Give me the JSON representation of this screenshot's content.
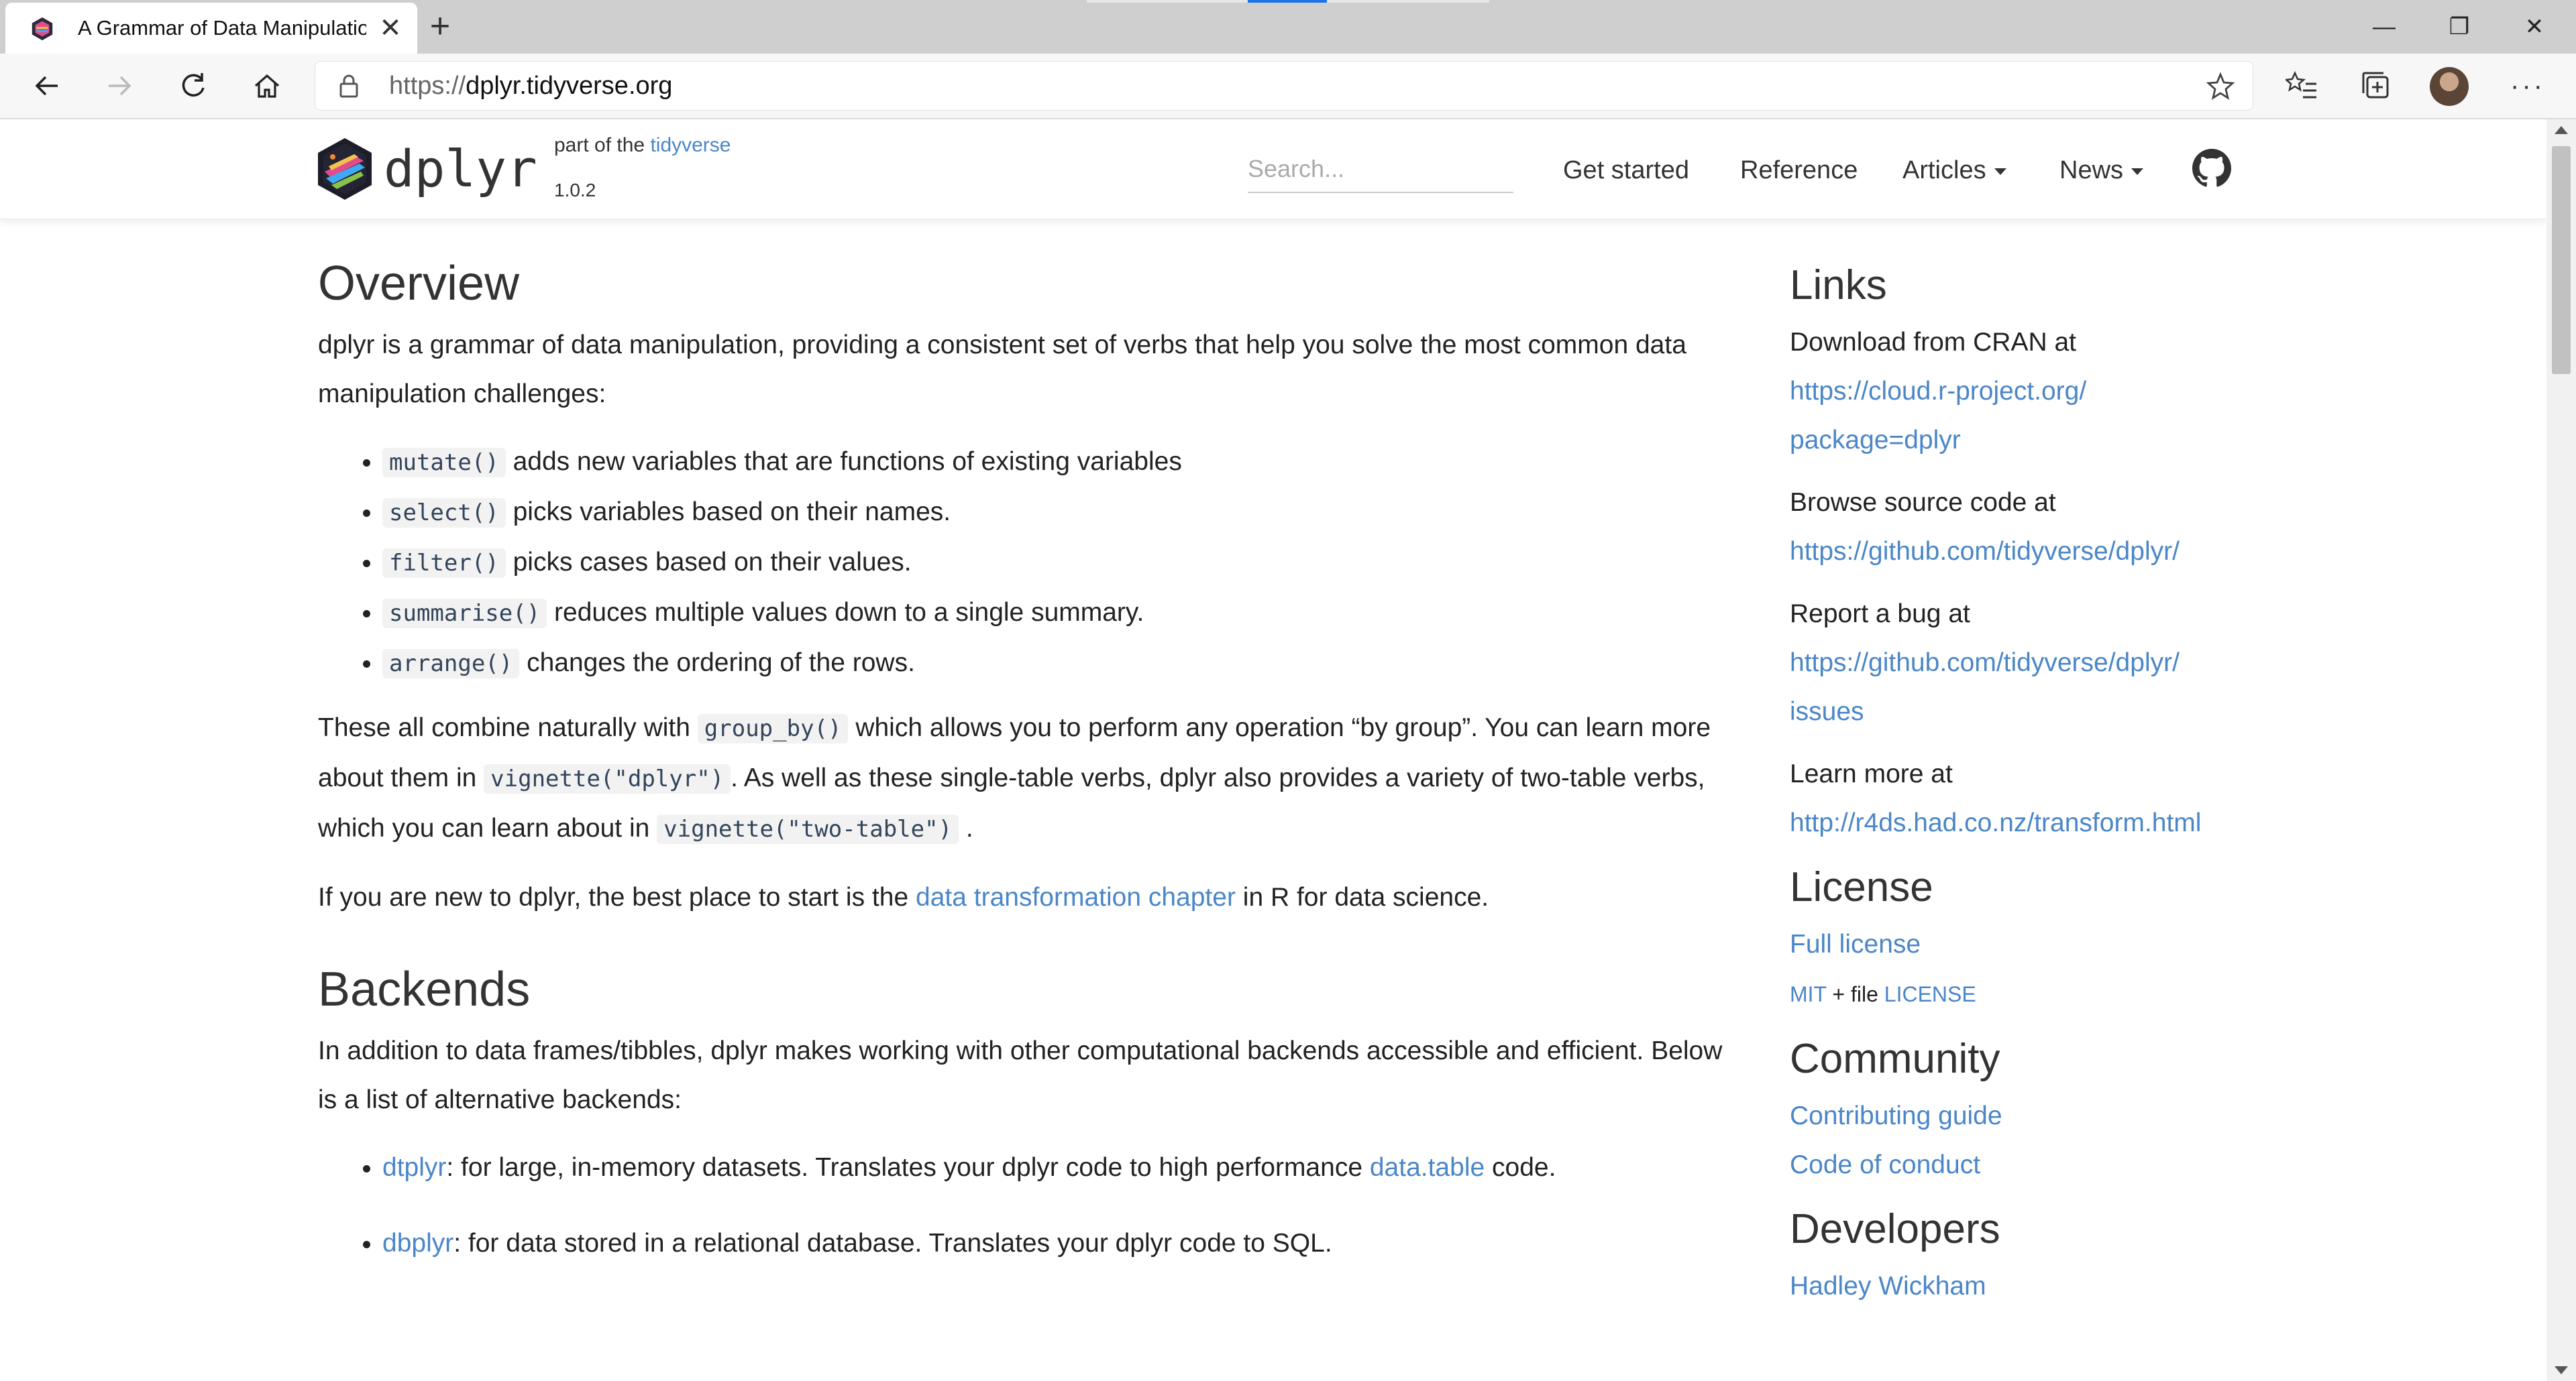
{
  "browser": {
    "tab_title": "A Grammar of Data Manipulation",
    "new_tab_label": "+",
    "window": {
      "minimize": "—",
      "restore": "❐",
      "close": "✕"
    },
    "url_protocol": "https://",
    "url_host": "dplyr.tidyverse.org",
    "icons": [
      "back-icon",
      "forward-icon",
      "refresh-icon",
      "home-icon",
      "lock-icon",
      "favorite-star-icon",
      "favorites-list-icon",
      "collections-icon",
      "profile-avatar",
      "more-icon"
    ],
    "accent": "#1a73e8"
  },
  "site": {
    "brand": "dplyr",
    "part_of_prefix": "part of the",
    "part_of_link": "tidyverse",
    "version": "1.0.2",
    "search_placeholder": "Search...",
    "nav": {
      "get_started": "Get started",
      "reference": "Reference",
      "articles": "Articles",
      "news": "News"
    },
    "link_color": "#4a86c8"
  },
  "overview": {
    "heading": "Overview",
    "intro": "dplyr is a grammar of data manipulation, providing a consistent set of verbs that help you solve the most common data manipulation challenges:",
    "verbs": [
      {
        "code": "mutate()",
        "text": "adds new variables that are functions of existing variables"
      },
      {
        "code": "select()",
        "text": "picks variables based on their names."
      },
      {
        "code": "filter()",
        "text": "picks cases based on their values."
      },
      {
        "code": "summarise()",
        "text": "reduces multiple values down to a single summary."
      },
      {
        "code": "arrange()",
        "text": "changes the ordering of the rows."
      }
    ],
    "combine": {
      "t1": "These all combine naturally with",
      "c1": "group_by()",
      "t2": "which allows you to perform any operation “by group”. You can learn more about them in",
      "c2": "vignette(\"dplyr\")",
      "t3": ". As well as these single-table verbs, dplyr also provides a variety of two-table verbs, which you can learn about in",
      "c3": "vignette(\"two-table\")",
      "t4": "."
    },
    "new_to": {
      "t1": "If you are new to dplyr, the best place to start is the",
      "link": "data transformation chapter",
      "t2": "in R for data science."
    }
  },
  "backends": {
    "heading": "Backends",
    "intro": "In addition to data frames/tibbles, dplyr makes working with other computational backends accessible and efficient. Below is a list of alternative backends:",
    "items": [
      {
        "link": "dtplyr",
        "t1": ": for large, in-memory datasets. Translates your dplyr code to high performance",
        "link2": "data.table",
        "t2": "code."
      },
      {
        "link": "dbplyr",
        "t1": ": for data stored in a relational database. Translates your dplyr code to SQL.",
        "link2": "",
        "t2": ""
      }
    ]
  },
  "sidebar": {
    "links_heading": "Links",
    "cran_label": "Download from CRAN at",
    "cran_url_1": "https://cloud.r-project.org/",
    "cran_url_2": "package=dplyr",
    "source_label": "Browse source code at",
    "source_url": "https://github.com/tidyverse/dplyr/",
    "bug_label": "Report a bug at",
    "bug_url_1": "https://github.com/tidyverse/dplyr/",
    "bug_url_2": "issues",
    "learn_label": "Learn more at",
    "learn_url": "http://r4ds.had.co.nz/transform.html",
    "license_heading": "License",
    "full_license": "Full license",
    "mit": "MIT",
    "plus_file": "+ file",
    "license_file": "LICENSE",
    "community_heading": "Community",
    "contributing": "Contributing guide",
    "conduct": "Code of conduct",
    "developers_heading": "Developers",
    "developer_1": "Hadley Wickham"
  }
}
